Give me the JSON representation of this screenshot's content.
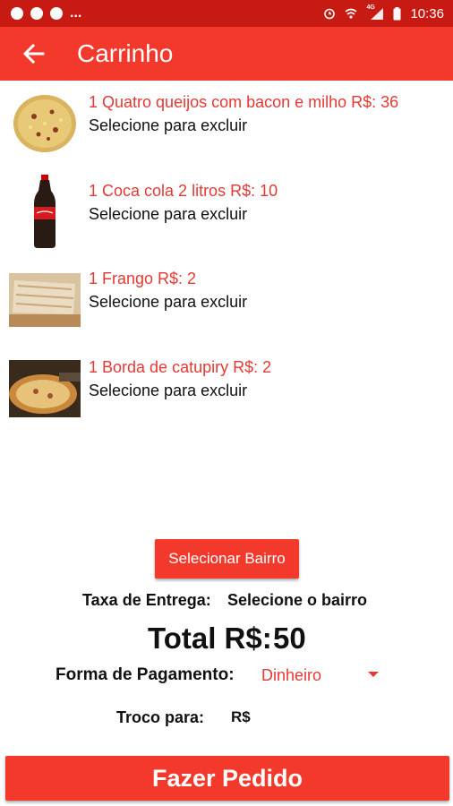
{
  "status_bar": {
    "left_icons": [
      "facebook-icon",
      "whatsapp-icon",
      "facebook-icon"
    ],
    "more": "...",
    "right_icons": [
      "alarm-icon",
      "wifi-icon",
      "signal-icon",
      "battery-icon"
    ],
    "network": "4G",
    "time": "10:36"
  },
  "app_bar": {
    "title": "Carrinho",
    "back_icon": "arrow-left-icon",
    "background": "#f2392c",
    "status_background": "#c71a12"
  },
  "cart_items": [
    {
      "name": "1 Quatro queijos com bacon e milho R$: 36",
      "action": "Selecione para excluir",
      "thumbnail": "pizza-image"
    },
    {
      "name": "1 Coca cola 2 litros R$: 10",
      "action": "Selecione para excluir",
      "thumbnail": "soda-bottle-image"
    },
    {
      "name": "1 Frango  R$: 2",
      "action": "Selecione para excluir",
      "thumbnail": "chicken-pizza-image"
    },
    {
      "name": "1 Borda de catupiry R$: 2",
      "action": "Selecione para excluir",
      "thumbnail": "stuffed-crust-image"
    }
  ],
  "delivery": {
    "select_button": "Selecionar Bairro",
    "fee_label": "Taxa de Entrega:",
    "fee_value": "Selecione o bairro"
  },
  "total": {
    "label": "Total R$:",
    "value": "50"
  },
  "payment": {
    "label": "Forma de Pagamento:",
    "selected": "Dinheiro",
    "caret_icon": "dropdown-caret-icon"
  },
  "change": {
    "label": "Troco para:",
    "placeholder": "R$"
  },
  "order_button": "Fazer Pedido",
  "colors": {
    "accent": "#f2392c",
    "item_text": "#e53935",
    "body_text": "#111111"
  }
}
